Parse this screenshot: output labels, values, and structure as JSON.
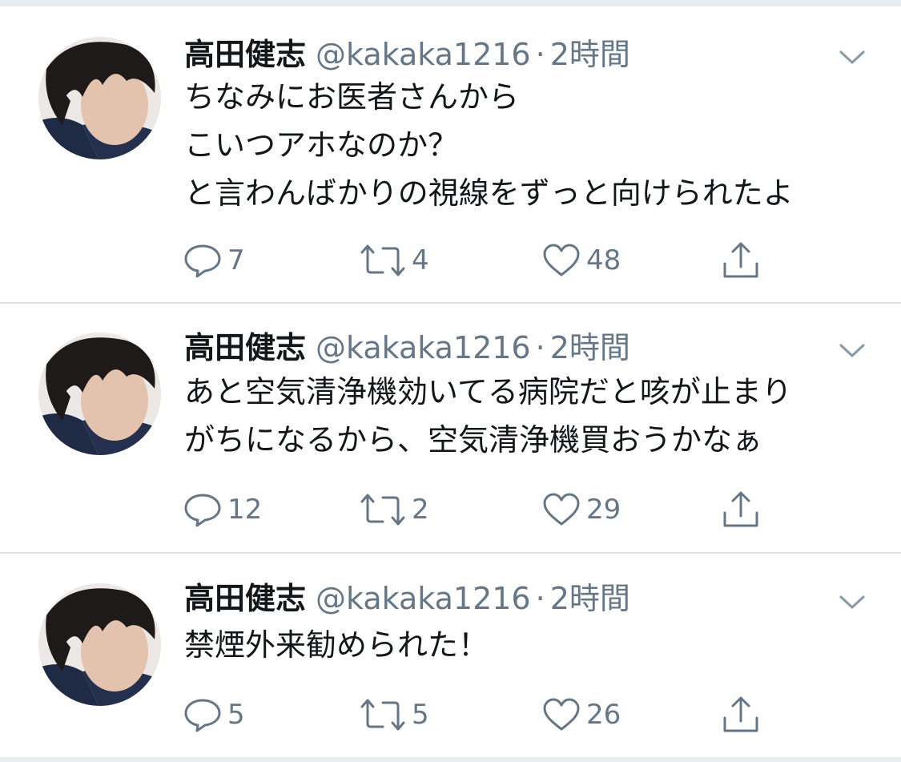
{
  "tweets": [
    {
      "display_name": "高田健志",
      "handle": "@kakaka1216",
      "separator": "·",
      "time": "2時間",
      "lines": [
        "ちなみにお医者さんから",
        "こいつアホなのか？",
        "と言わんばかりの視線をずっと向けられたよ"
      ],
      "replies": "7",
      "retweets": "4",
      "likes": "48"
    },
    {
      "display_name": "高田健志",
      "handle": "@kakaka1216",
      "separator": "·",
      "time": "2時間",
      "lines": [
        "あと空気清浄機効いてる病院だと咳が止まり",
        "がちになるから、空気清浄機買おうかなぁ"
      ],
      "replies": "12",
      "retweets": "2",
      "likes": "29"
    },
    {
      "display_name": "高田健志",
      "handle": "@kakaka1216",
      "separator": "·",
      "time": "2時間",
      "lines": [
        "禁煙外来勧められた！"
      ],
      "replies": "5",
      "retweets": "5",
      "likes": "26"
    }
  ],
  "icons": {
    "reply": "reply-icon",
    "retweet": "retweet-icon",
    "like": "heart-icon",
    "share": "share-icon",
    "caret": "chevron-down-icon",
    "avatar": "avatar"
  },
  "colors": {
    "text": "#14171a",
    "secondary": "#657786",
    "divider": "#e6ecf0",
    "background": "#ffffff"
  }
}
